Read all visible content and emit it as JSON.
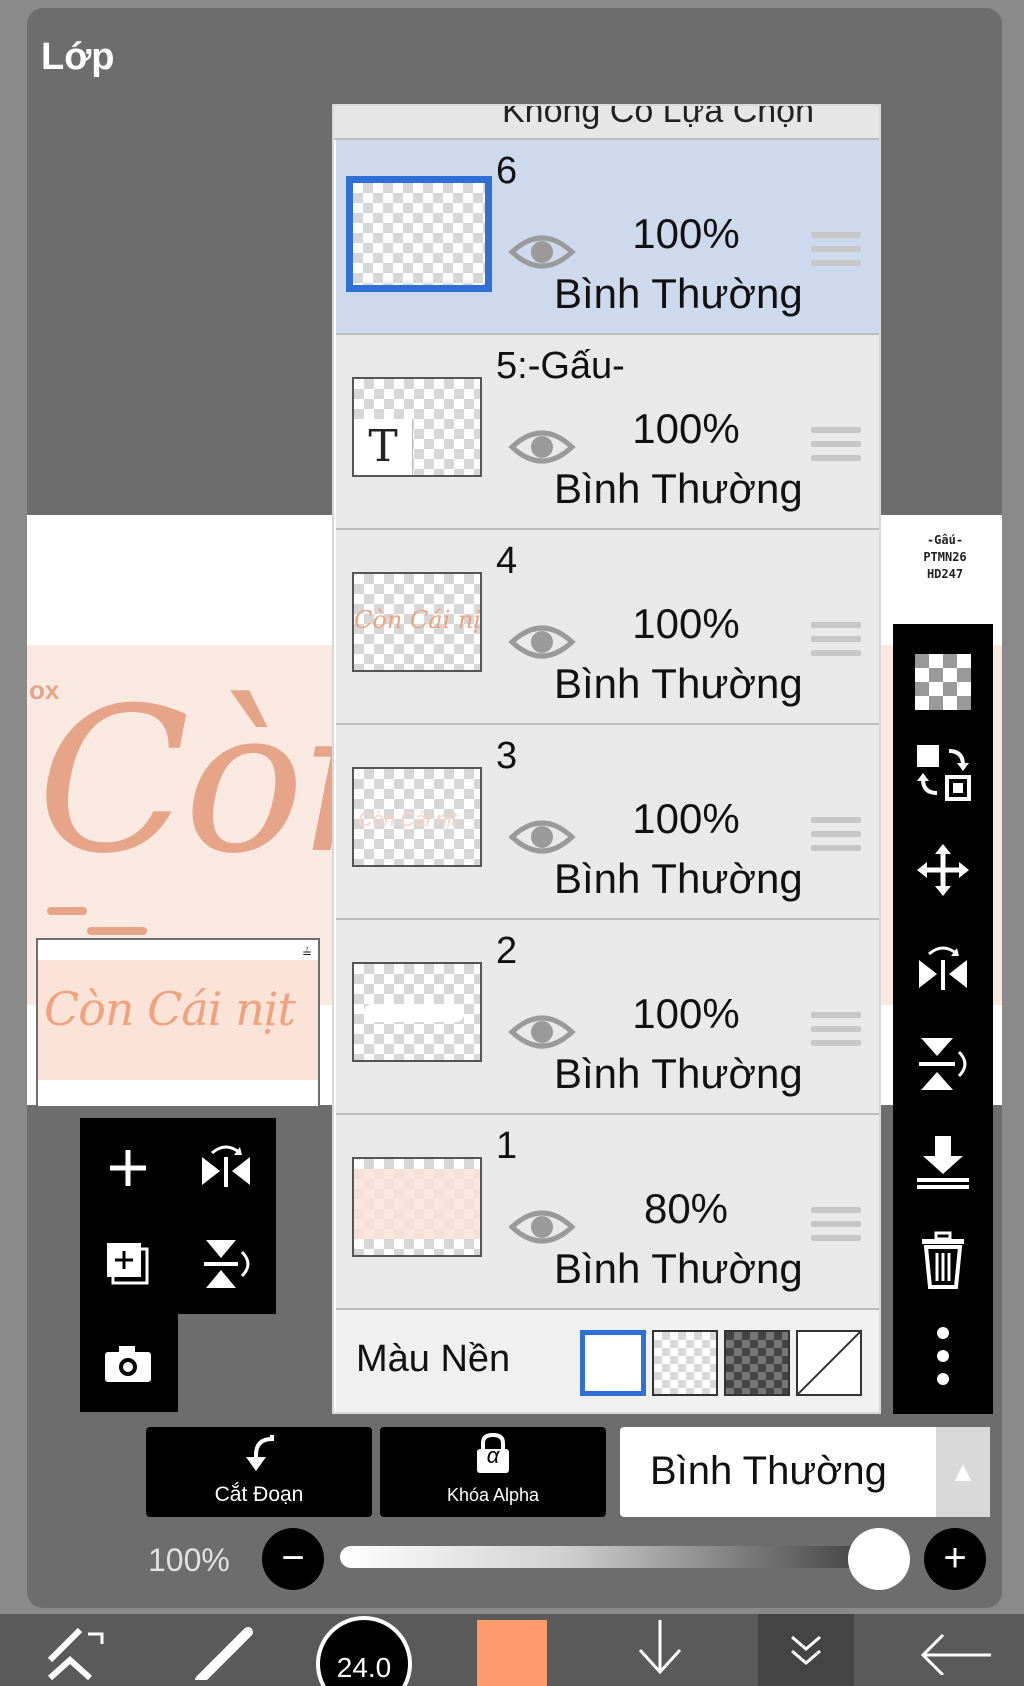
{
  "panel": {
    "title": "Lớp"
  },
  "canvas": {
    "watermark_lines": [
      "-Gấu-",
      "PTMN26",
      "HD247"
    ],
    "preview_text": "Còn",
    "preview_ox": "ox"
  },
  "thumbnail": {
    "text": "Còn Cái nịt",
    "corner": "≟"
  },
  "layers": {
    "top_cut_text": "Không Có Lựa Chọn",
    "rows": [
      {
        "name": "6",
        "opacity": "100%",
        "blend": "Bình Thường",
        "selected": true
      },
      {
        "name": "5:-Gấu-",
        "opacity": "100%",
        "blend": "Bình Thường",
        "thumb_text": "T"
      },
      {
        "name": "4",
        "opacity": "100%",
        "blend": "Bình Thường",
        "thumb_text": "Còn Cái nịt"
      },
      {
        "name": "3",
        "opacity": "100%",
        "blend": "Bình Thường",
        "thumb_text": "Còn Cái nịt"
      },
      {
        "name": "2",
        "opacity": "100%",
        "blend": "Bình Thường"
      },
      {
        "name": "1",
        "opacity": "80%",
        "blend": "Bình Thường"
      }
    ],
    "background_label": "Màu Nền"
  },
  "bottom": {
    "clip_label": "Cắt Đoạn",
    "alpha_lock_label": "Khóa Alpha",
    "alpha_symbol": "α",
    "blend_mode": "Bình Thường",
    "opacity_label": "100%",
    "opacity_value": 1.0
  },
  "toolbar": {
    "brush_size": "24.0"
  },
  "colors": {
    "accent": "#2f6fd6",
    "current_color": "#ff9a6c",
    "panel": "#6d6d6d"
  },
  "icons": {
    "left_tools": [
      "add-layer-icon",
      "flip-horizontal-icon",
      "duplicate-layer-icon",
      "flip-vertical-icon",
      "camera-icon"
    ],
    "right_tools": [
      "checkerboard-icon",
      "swap-layer-icon",
      "move-icon",
      "flip-horizontal-icon",
      "flip-vertical-icon",
      "merge-down-icon",
      "trash-icon",
      "more-icon"
    ]
  }
}
